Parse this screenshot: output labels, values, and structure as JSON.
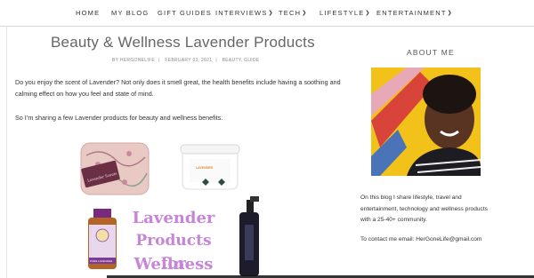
{
  "nav": {
    "items": [
      {
        "label": "HOME",
        "has_dropdown": false
      },
      {
        "label": "MY BLOG",
        "has_dropdown": false
      },
      {
        "label": "GIFT GUIDES",
        "has_dropdown": false
      },
      {
        "label": "INTERVIEWS",
        "has_dropdown": true
      },
      {
        "label": "TECH",
        "has_dropdown": true
      },
      {
        "label": "LIFESTYLE",
        "has_dropdown": true
      },
      {
        "label": "ENTERTAINMENT",
        "has_dropdown": true
      }
    ],
    "dropdown_icon": "chevron-down-icon"
  },
  "post": {
    "title": "Beauty & Wellness Lavender Products",
    "meta": {
      "author": "BY HERGONELIFE",
      "date": "FEBRUARY 03, 2021",
      "category": "BEAUTY, GUIDE"
    },
    "paragraph1": "Do you enjoy the scent of Lavender? Not only does it smell great, the health benefits include having a soothing and calming effect on how you feel and state of mind.",
    "paragraph2": "So I’m sharing a few Lavender products for beauty and wellness benefits.",
    "image": {
      "line1": "Lavender",
      "line2": "Products for",
      "line3": "Wellness",
      "eye_pillow_tag": "Lavender Scents",
      "oil_label": "PURE LAVENDER"
    }
  },
  "sidebar": {
    "title": "ABOUT ME",
    "about_text": "On this blog I share lifestyle, travel and entertainment, technology and wellness products with a 25-40+ community.",
    "contact": "To contact me email: HerGoneLife@gmail.com"
  },
  "colors": {
    "promo_purple": "#c784d8",
    "avatar_yellow": "#f3c21a",
    "avatar_red": "#d9443a"
  }
}
